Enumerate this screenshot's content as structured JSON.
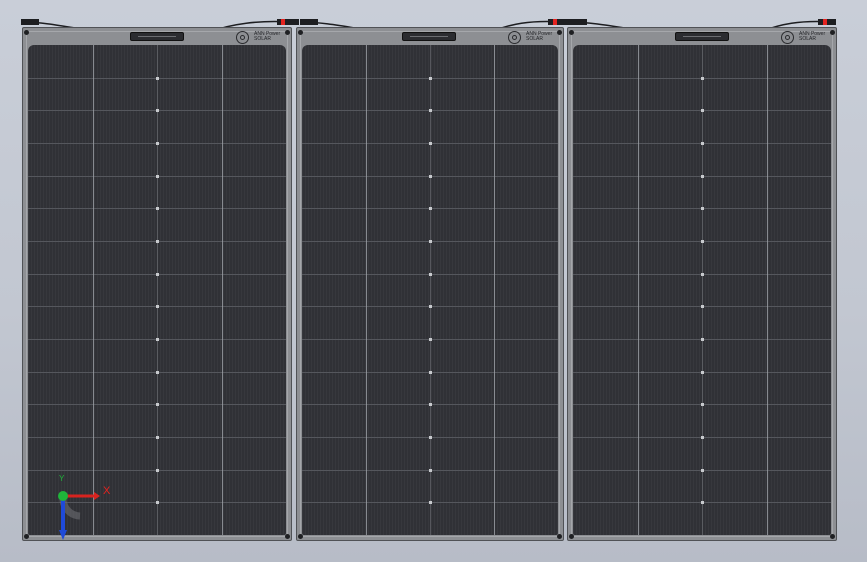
{
  "viewport": {
    "background": "#c5cad4",
    "panels": [
      {
        "id": "panel-1",
        "brand_line1": "ANN Power",
        "brand_line2": "SOLAR"
      },
      {
        "id": "panel-2",
        "brand_line1": "ANN Power",
        "brand_line2": "SOLAR"
      },
      {
        "id": "panel-3",
        "brand_line1": "ANN Power",
        "brand_line2": "SOLAR"
      }
    ],
    "panel_color": "#303136",
    "frame_color": "#8d8f93",
    "connector_color": "#e4231f"
  },
  "triad": {
    "x_label": "X",
    "y_label": "Y",
    "x_color": "#d8231f",
    "y_color": "#1fb53a",
    "z_color": "#1f4ad8"
  }
}
